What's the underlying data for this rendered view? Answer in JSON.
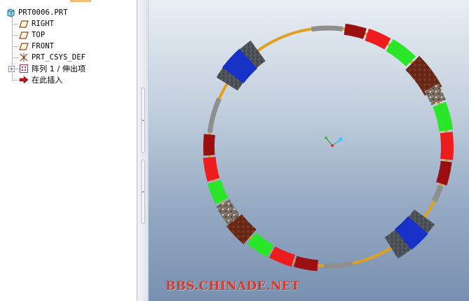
{
  "model_tree": {
    "root": {
      "label": "PRT0006.PRT",
      "icon": "part-icon"
    },
    "items": [
      {
        "label": "RIGHT",
        "icon": "datum-plane-icon"
      },
      {
        "label": "TOP",
        "icon": "datum-plane-icon"
      },
      {
        "label": "FRONT",
        "icon": "datum-plane-icon"
      },
      {
        "label": "PRT_CSYS_DEF",
        "icon": "csys-icon"
      },
      {
        "label": "阵列 1 / 伸出项",
        "icon": "pattern-icon",
        "expandable": true,
        "expander": "+"
      },
      {
        "label": "在此插入",
        "icon": "insert-arrow-icon"
      }
    ]
  },
  "viewport": {
    "watermark": "BBS.CHINADE.NET",
    "colors": {
      "background_top": "#e9eef4",
      "background_bottom": "#7990b0",
      "ring_orange": "#e0a020",
      "ring_grey": "#8f8f8f",
      "segment_red": "#ee1d1d",
      "segment_green": "#29e629",
      "segment_dark_red": "#9a1010",
      "segment_blue": "#1832c8",
      "segment_stone": "#4a4f55",
      "segment_rust": "#6b2a18"
    }
  }
}
